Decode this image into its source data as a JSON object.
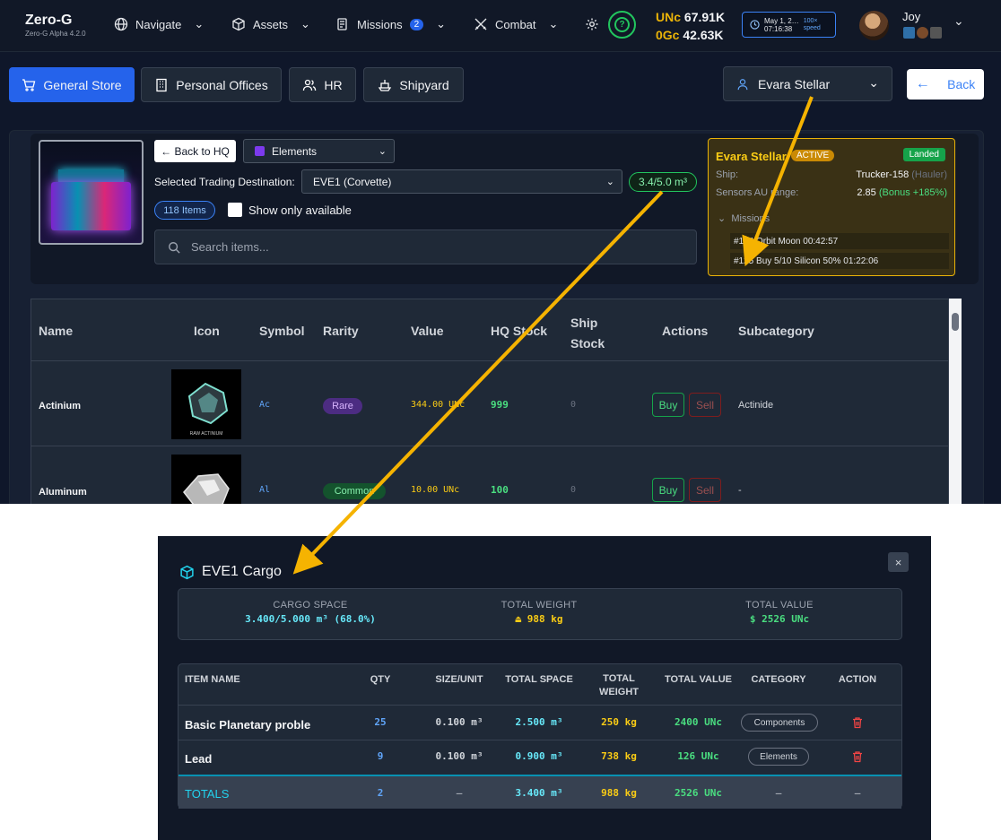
{
  "brand": {
    "title": "Zero-G",
    "version": "Zero-G Alpha 4.2.0"
  },
  "nav": {
    "navigate": "Navigate",
    "assets": "Assets",
    "missions": "Missions",
    "missions_badge": "2",
    "combat": "Combat"
  },
  "currency": {
    "unc_key": "UNc",
    "unc_val": "67.91K",
    "ogc_key": "0Gc",
    "ogc_val": "42.63K"
  },
  "clock": {
    "date": "May 1, 2…",
    "time": "07:16:38",
    "speed_a": "100×",
    "speed_b": "speed"
  },
  "user": {
    "name": "Joy"
  },
  "tabs": {
    "general": "General Store",
    "offices": "Personal Offices",
    "hr": "HR",
    "shipyard": "Shipyard"
  },
  "character_select": "Evara Stellar",
  "back_label": "Back",
  "store": {
    "back_hq": "← Back to HQ",
    "category": "Elements",
    "dest_label": "Selected Trading Destination:",
    "destination": "EVE1 (Corvette)",
    "capacity": "3.4/5.0 m³",
    "items_count": "118 Items",
    "only_available": "Show only available",
    "search_placeholder": "Search items..."
  },
  "card": {
    "name": "Evara Stellar",
    "status": "ACTIVE",
    "landed": "Landed",
    "ship_label": "Ship:",
    "ship_value": "Trucker-158",
    "ship_type": "(Hauler)",
    "sensors_label": "Sensors AU range:",
    "sensors_value": "2.85",
    "sensors_bonus": "(Bonus +185%)",
    "missions_label": "Missions",
    "mission1": "#124 Orbit Moon 00:42:57",
    "mission2": "#125 Buy 5/10 Silicon 50% 01:22:06"
  },
  "table": {
    "headers": {
      "name": "Name",
      "icon": "Icon",
      "symbol": "Symbol",
      "rarity": "Rarity",
      "value": "Value",
      "hq": "HQ Stock",
      "ship_a": "Ship",
      "ship_b": "Stock",
      "actions": "Actions",
      "sub": "Subcategory"
    },
    "rows": [
      {
        "name": "Actinium",
        "symbol": "Ac",
        "rarity": "Rare",
        "value": "344.00 UNc",
        "hq": "999",
        "ship": "0",
        "buy": "Buy",
        "sell": "Sell",
        "sub": "Actinide",
        "img_label": "RAW ACTINIUM"
      },
      {
        "name": "Aluminum",
        "symbol": "Al",
        "rarity": "Common",
        "value": "10.00 UNc",
        "hq": "100",
        "ship": "0",
        "buy": "Buy",
        "sell": "Sell",
        "sub": "-"
      }
    ]
  },
  "modal": {
    "title": "EVE1 Cargo",
    "close": "×",
    "cargo_space_label": "CARGO SPACE",
    "cargo_space_value": "3.400/5.000 m³ (68.0%)",
    "weight_label": "TOTAL WEIGHT",
    "weight_value": "988 kg",
    "value_label": "TOTAL VALUE",
    "value_value": "$ 2526 UNc",
    "headers": {
      "item": "ITEM NAME",
      "qty": "QTY",
      "size": "SIZE/UNIT",
      "space": "TOTAL SPACE",
      "weight_a": "TOTAL",
      "weight_b": "WEIGHT",
      "value": "TOTAL VALUE",
      "category": "CATEGORY",
      "action": "ACTION"
    },
    "rows": [
      {
        "item": "Basic Planetary proble",
        "qty": "25",
        "size": "0.100 m³",
        "space": "2.500 m³",
        "weight": "250 kg",
        "value": "2400 UNc",
        "category": "Components"
      },
      {
        "item": "Lead",
        "qty": "9",
        "size": "0.100 m³",
        "space": "0.900 m³",
        "weight": "738 kg",
        "value": "126 UNc",
        "category": "Elements"
      }
    ],
    "totals": {
      "label": "TOTALS",
      "qty": "2",
      "size": "—",
      "space": "3.400 m³",
      "weight": "988 kg",
      "value": "2526 UNc",
      "category": "—",
      "action": "—"
    }
  },
  "colors": {
    "accent": "#2563eb",
    "gold": "#eab308",
    "green": "#4ade80",
    "annotation_arrow": "#f5b301"
  }
}
